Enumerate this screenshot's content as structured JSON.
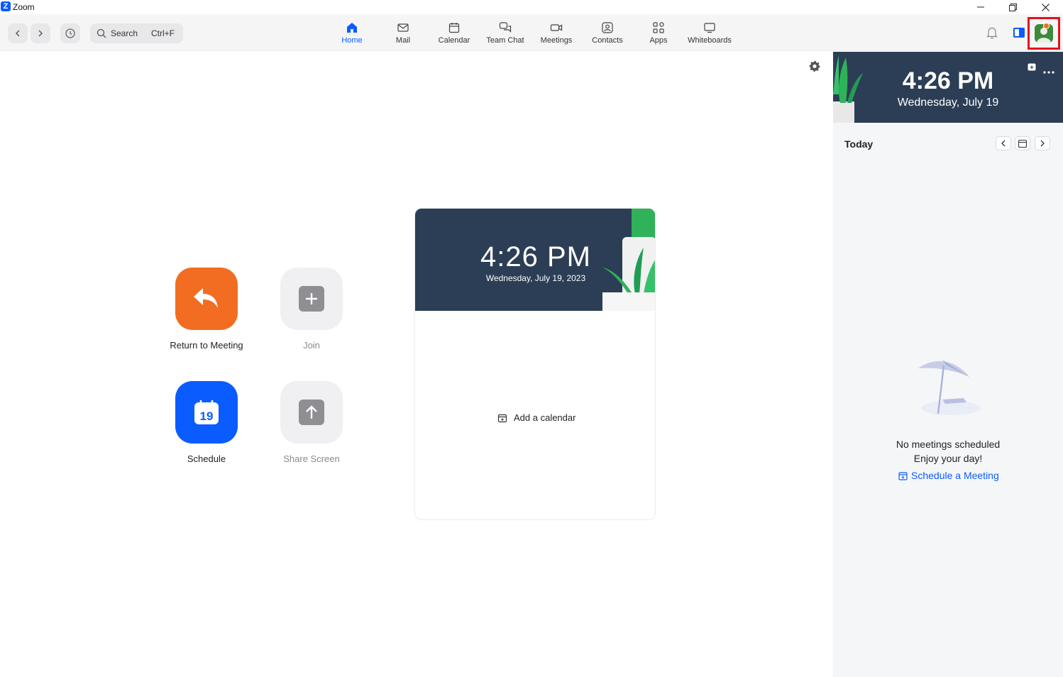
{
  "window": {
    "title": "Zoom",
    "logo_letter": "Z"
  },
  "search": {
    "placeholder": "Search",
    "shortcut": "Ctrl+F"
  },
  "nav": [
    {
      "label": "Home",
      "icon": "home-icon",
      "active": true
    },
    {
      "label": "Mail",
      "icon": "mail-icon"
    },
    {
      "label": "Calendar",
      "icon": "calendar-icon"
    },
    {
      "label": "Team Chat",
      "icon": "chat-icon"
    },
    {
      "label": "Meetings",
      "icon": "video-icon"
    },
    {
      "label": "Contacts",
      "icon": "contacts-icon"
    },
    {
      "label": "Apps",
      "icon": "apps-icon"
    },
    {
      "label": "Whiteboards",
      "icon": "whiteboard-icon"
    }
  ],
  "actions": {
    "return": {
      "label": "Return to Meeting",
      "color": "#f26d21"
    },
    "join": {
      "label": "Join"
    },
    "schedule": {
      "label": "Schedule",
      "day": "19",
      "color": "#0b5cff"
    },
    "share": {
      "label": "Share Screen"
    }
  },
  "calendar_card": {
    "time": "4:26 PM",
    "date": "Wednesday, July 19, 2023",
    "add_label": "Add a calendar"
  },
  "side_panel": {
    "time": "4:26 PM",
    "date": "Wednesday, July 19",
    "today_label": "Today",
    "empty_line1": "No meetings scheduled",
    "empty_line2": "Enjoy your day!",
    "schedule_link": "Schedule a Meeting"
  },
  "colors": {
    "accent": "#0b5cff",
    "banner": "#2c3e55",
    "highlight": "#e3131c"
  }
}
